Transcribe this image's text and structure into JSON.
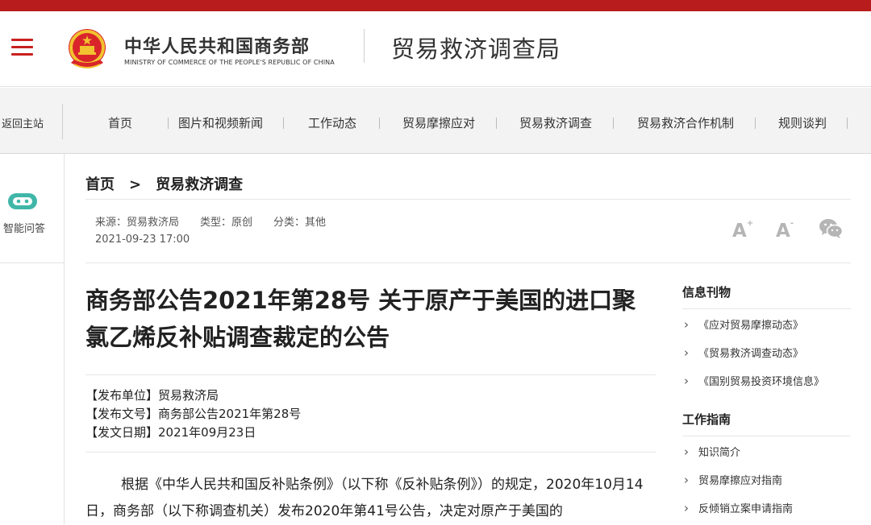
{
  "header": {
    "org_cn": "中华人民共和国商务部",
    "org_en": "MINISTRY OF COMMERCE OF THE PEOPLE'S REPUBLIC OF CHINA",
    "bureau": "贸易救济调查局",
    "brand_color": "#b81c1c"
  },
  "nav": {
    "back": "返回主站",
    "items": [
      "首页",
      "图片和视频新闻",
      "工作动态",
      "贸易摩擦应对",
      "贸易救济调查",
      "贸易救济合作机制",
      "规则谈判"
    ]
  },
  "side": {
    "assistant_label": "智能问答",
    "icon": "robot-icon"
  },
  "breadcrumb": {
    "home": "首页",
    "separator": ">",
    "current": "贸易救济调查"
  },
  "meta": {
    "source": "来源：贸易救济局",
    "type": "类型：原创",
    "category": "分类：其他",
    "date": "2021-09-23 17:00",
    "font_larger": "A",
    "font_smaller": "A",
    "share_icon": "wechat-icon"
  },
  "article": {
    "title": "商务部公告2021年第28号 关于原产于美国的进口聚氯乙烯反补贴调查裁定的公告",
    "publisher": "【发布单位】贸易救济局",
    "doc_no": "【发布文号】商务部公告2021年第28号",
    "issue_date": "【发文日期】2021年09月23日",
    "para1": "根据《中华人民共和国反补贴条例》（以下称《反补贴条例》）的规定，2020年10月14日，商务部（以下称调查机关）发布2020年第41号公告，决定对原产于美国的"
  },
  "right": {
    "pubs_title": "信息刊物",
    "pubs": [
      "《应对贸易摩擦动态》",
      "《贸易救济调查动态》",
      "《国别贸易投资环境信息》"
    ],
    "guide_title": "工作指南",
    "guides": [
      "知识简介",
      "贸易摩擦应对指南",
      "反倾销立案申请指南"
    ]
  }
}
